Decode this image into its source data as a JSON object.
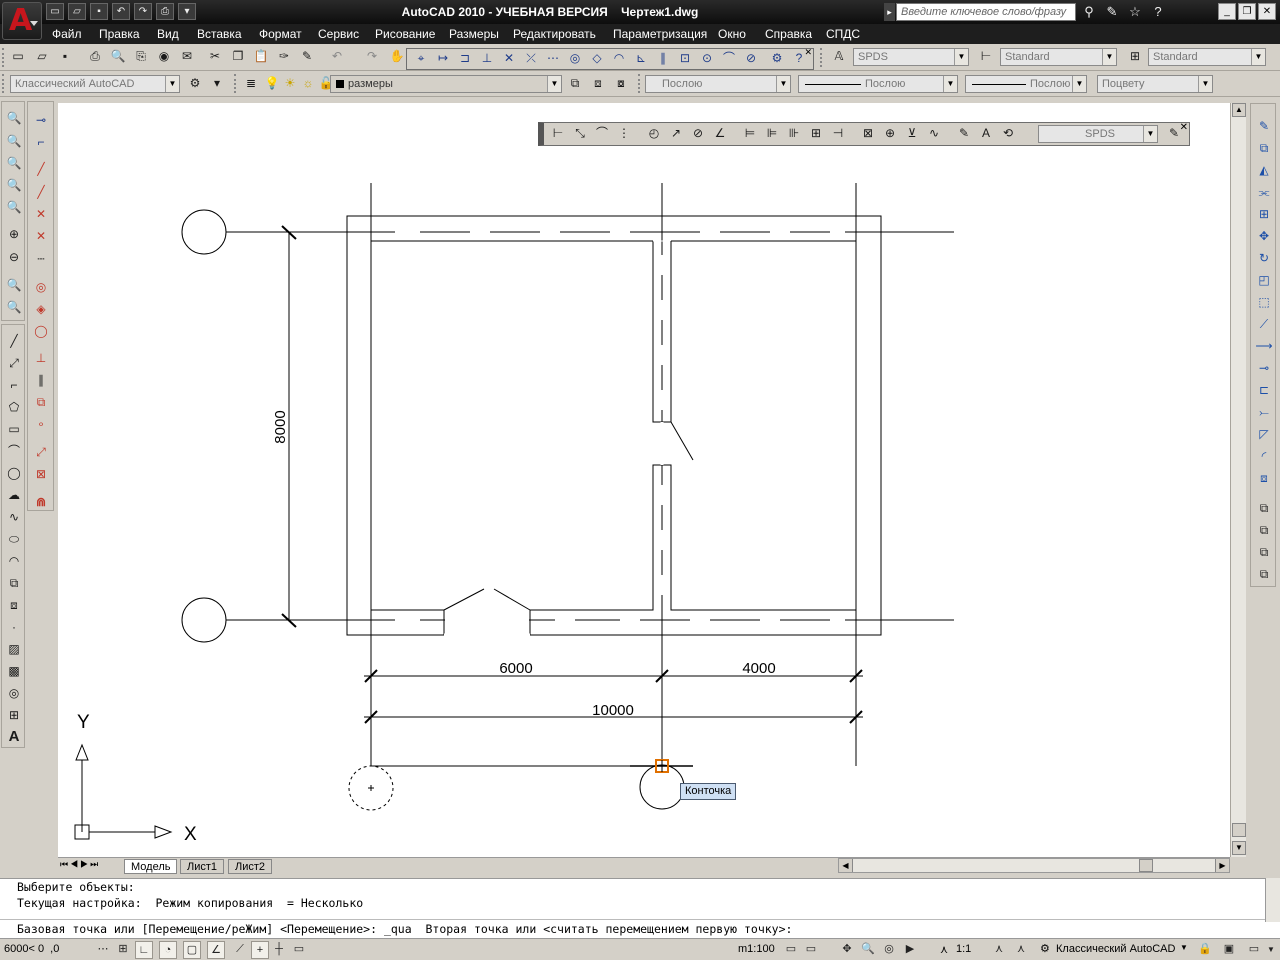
{
  "app": {
    "title": "AutoCAD 2010 - УЧЕБНАЯ ВЕРСИЯ    Чертеж1.dwg",
    "search_placeholder": "Введите ключевое слово/фразу"
  },
  "menu": [
    "Файл",
    "Правка",
    "Вид",
    "Вставка",
    "Формат",
    "Сервис",
    "Рисование",
    "Размеры",
    "Редактировать",
    "Параметризация",
    "Окно",
    "Справка",
    "СПДС"
  ],
  "toolbars": {
    "textstyle_value": "SPDS",
    "dimstyle_value": "Standard",
    "tablestyle_value": "Standard",
    "workspace_value": "Классический AutoCAD",
    "layer_value": "размеры",
    "color_value": "Послою",
    "linetype_value": "Послою",
    "lineweight_value": "Послою",
    "plotstyle_value": "Поцвету",
    "float_dimstyle_value": "SPDS"
  },
  "drawing": {
    "dim_vertical": "8000",
    "dim_left": "6000",
    "dim_right": "4000",
    "dim_total": "10000",
    "tooltip": "Конточка",
    "ucs_x": "X",
    "ucs_y": "Y"
  },
  "layout_tabs": [
    "Модель",
    "Лист1",
    "Лист2"
  ],
  "command_lines": [
    "Выберите объекты:",
    "Текущая настройка:  Режим копирования  = Несколько",
    "Базовая точка или [Перемещение/реЖим] <Перемещение>: _qua  Вторая точка или <считать перемещением первую точку>:"
  ],
  "status": {
    "coords": "6000< 0  ,0",
    "annotation_scale": "m1:100",
    "scale_ratio": "1:1",
    "workspace": "Классический AutoCAD"
  },
  "colors": {
    "title_bg": "#1a1a1a",
    "menu_bg": "#1e1e1e",
    "toolbar_bg": "#d4d0c8",
    "canvas_bg": "#ffffff",
    "snap_marker": "#e07000",
    "logo_red": "#c8161d"
  }
}
